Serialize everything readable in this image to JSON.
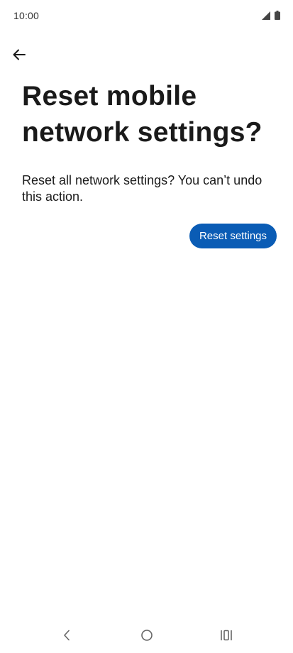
{
  "status_bar": {
    "time": "10:00",
    "icons": [
      "signal-icon",
      "battery-icon"
    ]
  },
  "header": {
    "back_icon": "arrow-left-icon"
  },
  "dialog": {
    "title": "Reset mobile network settings?",
    "description": "Reset all network settings? You can’t undo this action.",
    "reset_button_label": "Reset settings"
  },
  "nav_bar": {
    "icons": [
      "nav-back-icon",
      "nav-home-icon",
      "nav-recents-icon"
    ]
  },
  "colors": {
    "accent": "#0a5cb5",
    "background": "#ffffff",
    "text": "#1a1a1a"
  }
}
